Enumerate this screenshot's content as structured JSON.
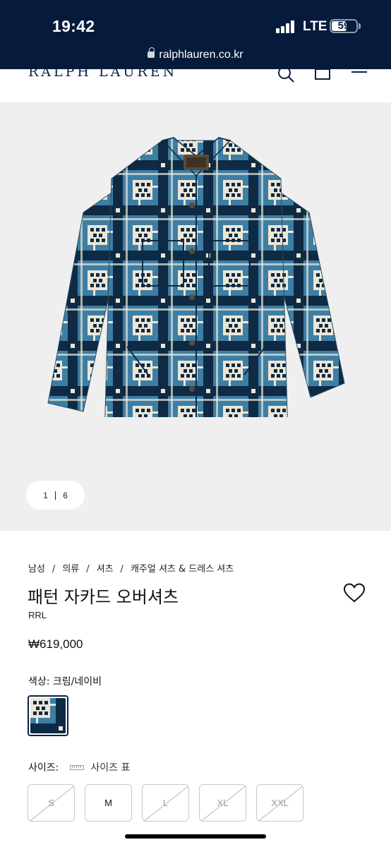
{
  "status_bar": {
    "time": "19:42",
    "network": "LTE",
    "battery": "59",
    "battery_level": 0.59,
    "url": "ralphlauren.co.kr"
  },
  "header": {
    "logo": "RALPH LAUREN",
    "icons": [
      "search-icon",
      "bag-icon",
      "menu-icon"
    ]
  },
  "gallery": {
    "current": "1",
    "total": "6"
  },
  "breadcrumb": [
    {
      "label": "남성"
    },
    {
      "label": "의류"
    },
    {
      "label": "셔츠"
    },
    {
      "label": "캐주얼 셔츠 & 드레스 셔츠"
    }
  ],
  "breadcrumb_separator": "/",
  "product": {
    "title": "패턴 자카드 오버셔츠",
    "brand": "RRL",
    "price": "₩619,000",
    "color_label": "색상: 크림/네이비",
    "size_label": "사이즈:",
    "size_chart_link": "사이즈 표",
    "sizes": [
      {
        "label": "S",
        "available": false
      },
      {
        "label": "M",
        "available": true
      },
      {
        "label": "L",
        "available": false
      },
      {
        "label": "XL",
        "available": false
      },
      {
        "label": "XXL",
        "available": false
      }
    ]
  },
  "colors": {
    "status_bar_bg": "#061b3b",
    "brand_navy": "#0a2144",
    "gallery_bg": "#efefef",
    "shirt_blue": "#3d7ea4",
    "shirt_navy": "#0e2a44",
    "shirt_cream": "#ece6d6"
  }
}
